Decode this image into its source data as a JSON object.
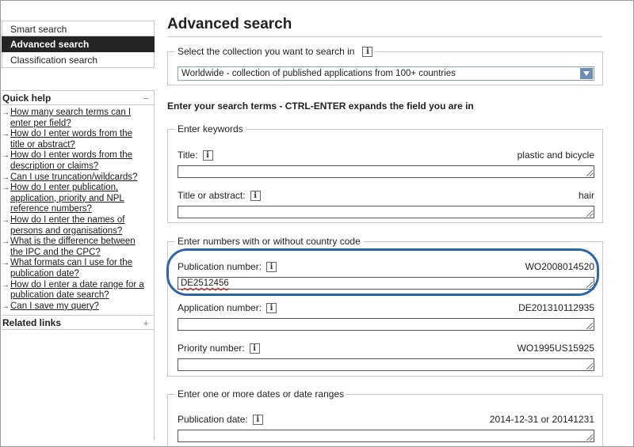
{
  "sidebar": {
    "nav": [
      "Smart search",
      "Advanced search",
      "Classification search"
    ],
    "quick_help": {
      "title": "Quick help",
      "toggle": "−",
      "items": [
        [
          "How many search terms can I",
          "enter per field?"
        ],
        [
          "How do I enter words from the",
          "title or abstract?"
        ],
        [
          "How do I enter words from the",
          "description or claims?"
        ],
        [
          "Can I use truncation/wildcards?"
        ],
        [
          "How do I enter publication,",
          "application, priority and NPL",
          "reference numbers?"
        ],
        [
          "How do I enter the names of",
          "persons and organisations?"
        ],
        [
          "What is the difference between",
          "the IPC and the CPC?"
        ],
        [
          "What formats can I use for the",
          "publication date?"
        ],
        [
          "How do I enter a date range for a",
          "publication date search?"
        ],
        [
          "Can I save my query?"
        ]
      ],
      "arrow": "→"
    },
    "related_links": {
      "title": "Related links",
      "toggle": "+"
    }
  },
  "main": {
    "title": "Advanced search",
    "collection": {
      "legend": "Select the collection you want to search in",
      "selected": "Worldwide - collection of published applications from 100+ countries"
    },
    "instruction": "Enter your search terms - CTRL-ENTER expands the field you are in",
    "keywords": {
      "legend": "Enter keywords",
      "fields": [
        {
          "label": "Title:",
          "example": "plastic and bicycle",
          "value": ""
        },
        {
          "label": "Title or abstract:",
          "example": "hair",
          "value": ""
        }
      ]
    },
    "numbers": {
      "legend": "Enter numbers with or without country code",
      "fields": [
        {
          "label": "Publication number:",
          "example": "WO2008014520",
          "value": "DE2512456"
        },
        {
          "label": "Application number:",
          "example": "DE201310112935",
          "value": ""
        },
        {
          "label": "Priority number:",
          "example": "WO1995US15925",
          "value": ""
        }
      ]
    },
    "dates": {
      "legend": "Enter one or more dates or date ranges",
      "fields": [
        {
          "label": "Publication date:",
          "example": "2014-12-31 or 20141231",
          "value": ""
        }
      ]
    },
    "info_glyph": "i"
  },
  "colors": {
    "active_nav": "#252525",
    "highlight": "#2e64a8",
    "select_border": "#8a9fbf"
  }
}
